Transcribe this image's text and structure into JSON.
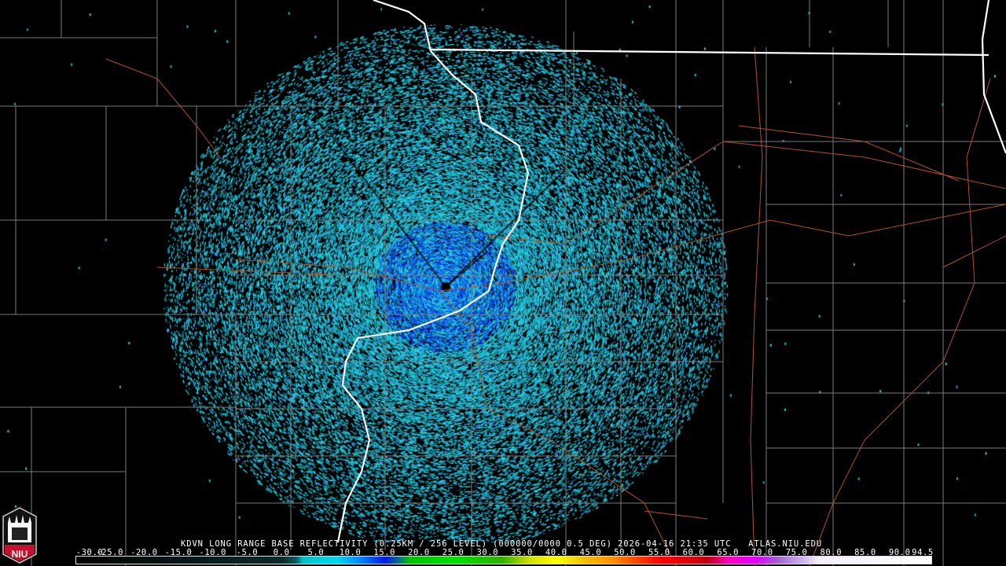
{
  "header": {
    "title": "KDVN LONG RANGE BASE REFLECTIVITY (0.25KM / 256 LEVEL) (000000/0000 0.5 DEG) 2026-04-16 21:35 UTC   ATLAS.NIU.EDU"
  },
  "logo": {
    "text": "NIU"
  },
  "legend": {
    "labels": [
      "-30.0",
      "-25.0",
      "-20.0",
      "-15.0",
      "-10.0",
      "-5.0",
      "0.0",
      "5.0",
      "10.0",
      "15.0",
      "20.0",
      "25.0",
      "30.0",
      "35.0",
      "40.0",
      "45.0",
      "50.0",
      "55.0",
      "60.0",
      "65.0",
      "70.0",
      "75.0",
      "80.0",
      "85.0",
      "90.0",
      "94.5"
    ],
    "min": -30.0,
    "max": 94.5,
    "stops": [
      {
        "v": -30,
        "c": "#000000"
      },
      {
        "v": 0,
        "c": "#0a2a2a"
      },
      {
        "v": 2,
        "c": "#0b5a60"
      },
      {
        "v": 3,
        "c": "#00c0c8"
      },
      {
        "v": 8,
        "c": "#00d8f0"
      },
      {
        "v": 11,
        "c": "#0090ff"
      },
      {
        "v": 15,
        "c": "#0018e8"
      },
      {
        "v": 17,
        "c": "#087080"
      },
      {
        "v": 18.5,
        "c": "#00c000"
      },
      {
        "v": 25,
        "c": "#00e000"
      },
      {
        "v": 32,
        "c": "#30b000"
      },
      {
        "v": 36,
        "c": "#d0e000"
      },
      {
        "v": 40,
        "c": "#ffff00"
      },
      {
        "v": 44,
        "c": "#f0c000"
      },
      {
        "v": 48,
        "c": "#ff9000"
      },
      {
        "v": 51,
        "c": "#ff5000"
      },
      {
        "v": 55,
        "c": "#ff0000"
      },
      {
        "v": 62,
        "c": "#c00010"
      },
      {
        "v": 65,
        "c": "#ff00c0"
      },
      {
        "v": 69,
        "c": "#e000ff"
      },
      {
        "v": 72,
        "c": "#a060d0"
      },
      {
        "v": 76,
        "c": "#d0b8f0"
      },
      {
        "v": 78,
        "c": "#f4eefa"
      },
      {
        "v": 94.5,
        "c": "#ffffff"
      }
    ]
  },
  "colors": {
    "state": "#ffffff",
    "county": "#7a7a7a",
    "road": "#b4502a",
    "echo": "#20c8d8"
  }
}
